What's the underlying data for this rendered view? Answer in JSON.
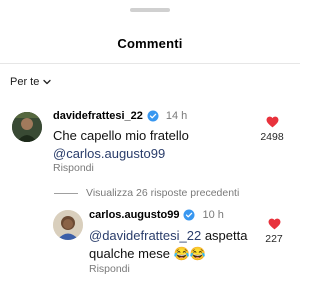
{
  "sheet": {
    "title": "Commenti"
  },
  "sort": {
    "label": "Per te"
  },
  "comments": [
    {
      "username": "davidefrattesi_22",
      "time": "14 h",
      "text_line1": "Che capello mio fratello",
      "mention": "@carlos.augusto99",
      "reply_label": "Rispondi",
      "likes": "2498"
    }
  ],
  "view_replies": {
    "label": "Visualizza 26 risposte precedenti"
  },
  "reply": {
    "username": "carlos.augusto99",
    "time": "10 h",
    "mention": "@davidefrattesi_22",
    "text_line1_rest": " aspetta",
    "text_line2": "qualche mese 😂😂",
    "reply_label": "Rispondi",
    "likes": "227"
  },
  "colors": {
    "like_heart": "#e8323c",
    "verified": "#3897f0",
    "mention": "#2a3d6b"
  }
}
